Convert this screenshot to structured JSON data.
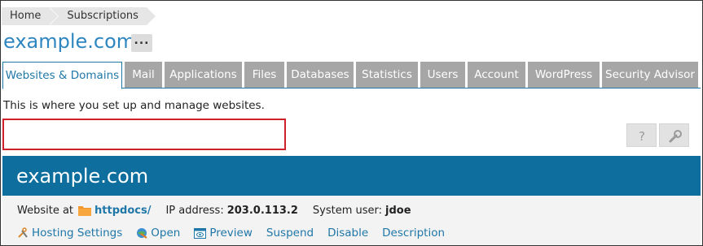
{
  "breadcrumb": [
    "Home",
    "Subscriptions"
  ],
  "page_title": "example.com",
  "more_button": "...",
  "tabs": [
    {
      "label": "Websites & Domains",
      "active": true
    },
    {
      "label": "Mail"
    },
    {
      "label": "Applications"
    },
    {
      "label": "Files"
    },
    {
      "label": "Databases"
    },
    {
      "label": "Statistics"
    },
    {
      "label": "Users"
    },
    {
      "label": "Account"
    },
    {
      "label": "WordPress"
    },
    {
      "label": "Security Advisor"
    }
  ],
  "intro_text": "This is where you set up and manage websites.",
  "toolbar": {
    "help_icon": "question-icon",
    "settings_icon": "wrench-icon"
  },
  "site": {
    "name": "example.com",
    "website_at_label": "Website at",
    "docroot_link": "httpdocs/",
    "ip_label": "IP address:",
    "ip_value": "203.0.113.2",
    "user_label": "System user:",
    "user_value": "jdoe",
    "actions": [
      "Hosting Settings",
      "Open",
      "Preview",
      "Suspend",
      "Disable",
      "Description"
    ]
  },
  "colors": {
    "accent": "#0e6f9f",
    "link": "#1f77a8",
    "title": "#2e86c1",
    "highlight": "#d0202a",
    "tab_inactive": "#a6a6a6"
  }
}
